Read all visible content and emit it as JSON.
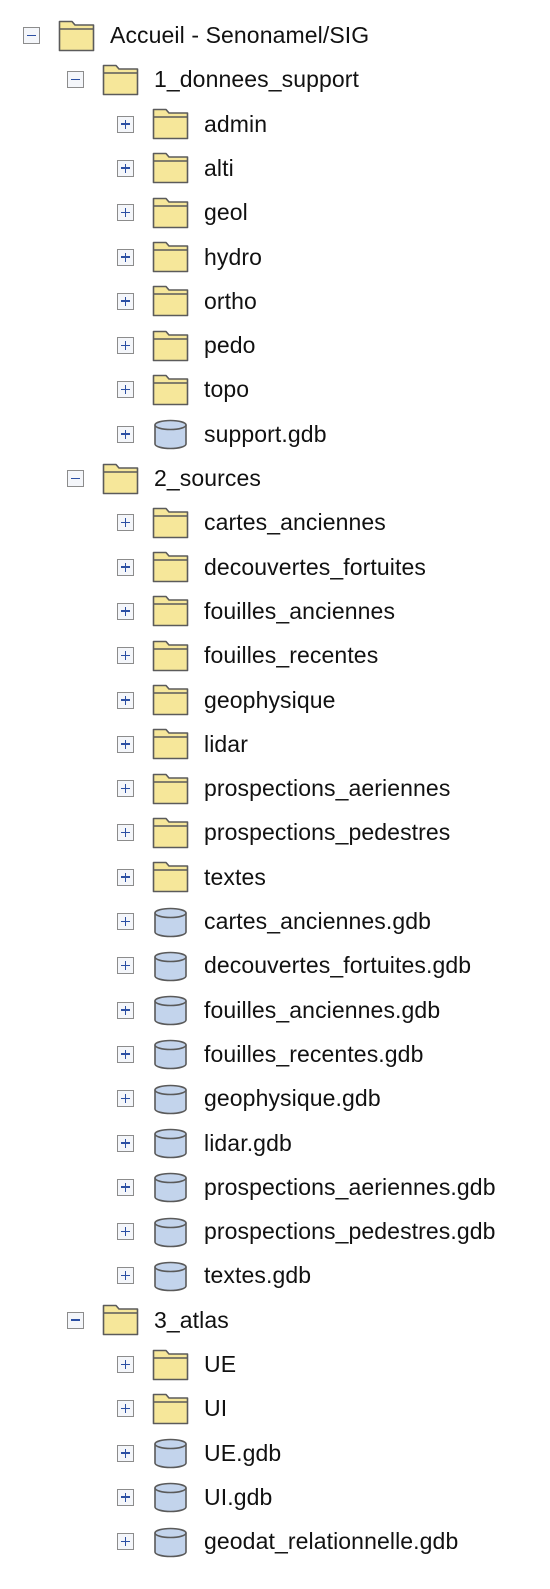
{
  "colors": {
    "folder_fill": "#f6e79a",
    "folder_stroke": "#5b5b5b",
    "db_fill": "#c3d4ec",
    "db_stroke": "#5a5a5a",
    "toggle_sign": "#2b4fa3"
  },
  "tree": {
    "label": "Accueil - Senonamel/SIG",
    "icon": "folder-icon",
    "expanded": true,
    "children": [
      {
        "label": "1_donnees_support",
        "icon": "folder-icon",
        "expanded": true,
        "children": [
          {
            "label": "admin",
            "icon": "folder-icon",
            "expanded": false
          },
          {
            "label": "alti",
            "icon": "folder-icon",
            "expanded": false
          },
          {
            "label": "geol",
            "icon": "folder-icon",
            "expanded": false
          },
          {
            "label": "hydro",
            "icon": "folder-icon",
            "expanded": false
          },
          {
            "label": "ortho",
            "icon": "folder-icon",
            "expanded": false
          },
          {
            "label": "pedo",
            "icon": "folder-icon",
            "expanded": false
          },
          {
            "label": "topo",
            "icon": "folder-icon",
            "expanded": false
          },
          {
            "label": "support.gdb",
            "icon": "database-icon",
            "expanded": false
          }
        ]
      },
      {
        "label": "2_sources",
        "icon": "folder-icon",
        "expanded": true,
        "children": [
          {
            "label": "cartes_anciennes",
            "icon": "folder-icon",
            "expanded": false
          },
          {
            "label": "decouvertes_fortuites",
            "icon": "folder-icon",
            "expanded": false
          },
          {
            "label": "fouilles_anciennes",
            "icon": "folder-icon",
            "expanded": false
          },
          {
            "label": "fouilles_recentes",
            "icon": "folder-icon",
            "expanded": false
          },
          {
            "label": "geophysique",
            "icon": "folder-icon",
            "expanded": false
          },
          {
            "label": "lidar",
            "icon": "folder-icon",
            "expanded": false
          },
          {
            "label": "prospections_aeriennes",
            "icon": "folder-icon",
            "expanded": false
          },
          {
            "label": "prospections_pedestres",
            "icon": "folder-icon",
            "expanded": false
          },
          {
            "label": "textes",
            "icon": "folder-icon",
            "expanded": false
          },
          {
            "label": "cartes_anciennes.gdb",
            "icon": "database-icon",
            "expanded": false
          },
          {
            "label": "decouvertes_fortuites.gdb",
            "icon": "database-icon",
            "expanded": false
          },
          {
            "label": "fouilles_anciennes.gdb",
            "icon": "database-icon",
            "expanded": false
          },
          {
            "label": "fouilles_recentes.gdb",
            "icon": "database-icon",
            "expanded": false
          },
          {
            "label": "geophysique.gdb",
            "icon": "database-icon",
            "expanded": false
          },
          {
            "label": "lidar.gdb",
            "icon": "database-icon",
            "expanded": false
          },
          {
            "label": "prospections_aeriennes.gdb",
            "icon": "database-icon",
            "expanded": false
          },
          {
            "label": "prospections_pedestres.gdb",
            "icon": "database-icon",
            "expanded": false
          },
          {
            "label": "textes.gdb",
            "icon": "database-icon",
            "expanded": false
          }
        ]
      },
      {
        "label": "3_atlas",
        "icon": "folder-icon",
        "expanded": true,
        "children": [
          {
            "label": "UE",
            "icon": "folder-icon",
            "expanded": false
          },
          {
            "label": "UI",
            "icon": "folder-icon",
            "expanded": false
          },
          {
            "label": "UE.gdb",
            "icon": "database-icon",
            "expanded": false
          },
          {
            "label": "UI.gdb",
            "icon": "database-icon",
            "expanded": false
          },
          {
            "label": "geodat_relationnelle.gdb",
            "icon": "database-icon",
            "expanded": false
          }
        ]
      }
    ]
  }
}
